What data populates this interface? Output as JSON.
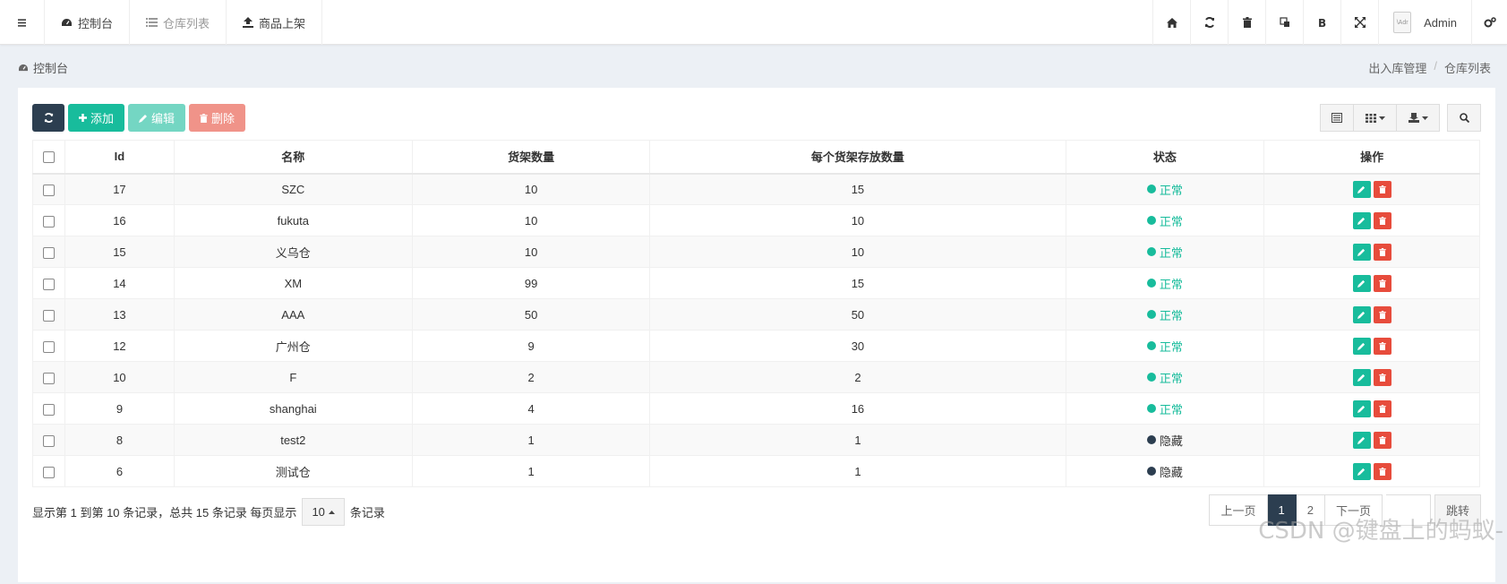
{
  "nav": {
    "tabs": [
      {
        "label": "控制台",
        "icon": "dashboard-icon"
      },
      {
        "label": "仓库列表",
        "icon": "list-icon"
      },
      {
        "label": "商品上架",
        "icon": "upload-icon"
      }
    ],
    "user_name": "Admin",
    "avatar_alt": "\\Adr"
  },
  "breadcrumb": {
    "left": "控制台",
    "right": [
      "出入库管理",
      "仓库列表"
    ]
  },
  "toolbar": {
    "add": "添加",
    "edit": "编辑",
    "delete": "删除"
  },
  "table": {
    "headers": [
      "Id",
      "名称",
      "货架数量",
      "每个货架存放数量",
      "状态",
      "操作"
    ],
    "rows": [
      {
        "id": "17",
        "name": "SZC",
        "shelves": "10",
        "per_shelf": "15",
        "status": "正常"
      },
      {
        "id": "16",
        "name": "fukuta",
        "shelves": "10",
        "per_shelf": "10",
        "status": "正常"
      },
      {
        "id": "15",
        "name": "义乌仓",
        "shelves": "10",
        "per_shelf": "10",
        "status": "正常"
      },
      {
        "id": "14",
        "name": "XM",
        "shelves": "99",
        "per_shelf": "15",
        "status": "正常"
      },
      {
        "id": "13",
        "name": "AAA",
        "shelves": "50",
        "per_shelf": "50",
        "status": "正常"
      },
      {
        "id": "12",
        "name": "广州仓",
        "shelves": "9",
        "per_shelf": "30",
        "status": "正常"
      },
      {
        "id": "10",
        "name": "F",
        "shelves": "2",
        "per_shelf": "2",
        "status": "正常"
      },
      {
        "id": "9",
        "name": "shanghai",
        "shelves": "4",
        "per_shelf": "16",
        "status": "正常"
      },
      {
        "id": "8",
        "name": "test2",
        "shelves": "1",
        "per_shelf": "1",
        "status": "隐藏"
      },
      {
        "id": "6",
        "name": "测试仓",
        "shelves": "1",
        "per_shelf": "1",
        "status": "隐藏"
      }
    ]
  },
  "pagination": {
    "info_prefix": "显示第 1 到第 10 条记录，总共 15 条记录 每页显示",
    "page_size": "10",
    "info_suffix": "条记录",
    "prev": "上一页",
    "pages": [
      "1",
      "2"
    ],
    "next": "下一页",
    "go": "跳转"
  },
  "colors": {
    "accent": "#18bc9c",
    "danger": "#e74c3c",
    "dark": "#2c3e50",
    "normal_status": "#18bc9c",
    "hidden_status": "#2c3e50"
  },
  "watermark": "CSDN @键盘上的蚂蚁-"
}
